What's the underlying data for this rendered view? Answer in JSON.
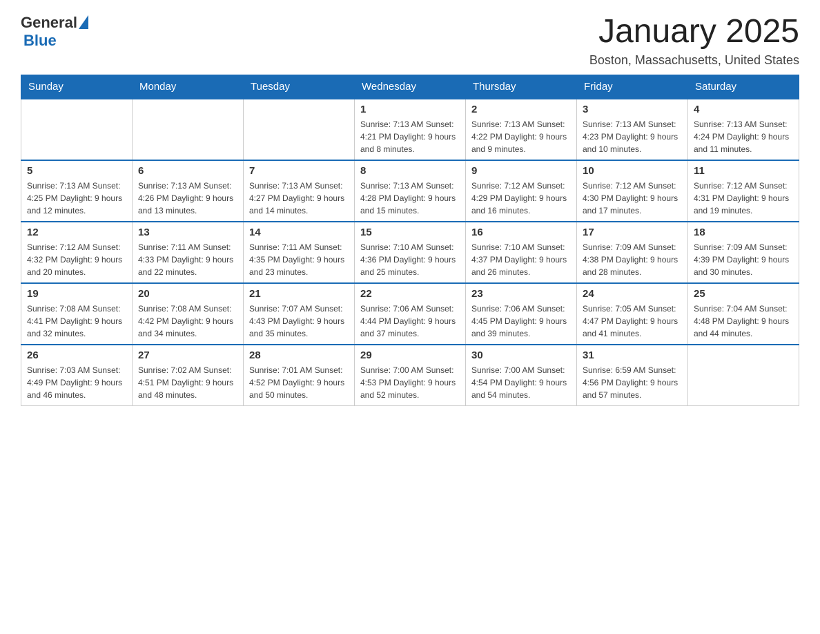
{
  "header": {
    "logo_general": "General",
    "logo_blue": "Blue",
    "month_title": "January 2025",
    "location": "Boston, Massachusetts, United States"
  },
  "weekdays": [
    "Sunday",
    "Monday",
    "Tuesday",
    "Wednesday",
    "Thursday",
    "Friday",
    "Saturday"
  ],
  "weeks": [
    [
      {
        "day": "",
        "info": ""
      },
      {
        "day": "",
        "info": ""
      },
      {
        "day": "",
        "info": ""
      },
      {
        "day": "1",
        "info": "Sunrise: 7:13 AM\nSunset: 4:21 PM\nDaylight: 9 hours\nand 8 minutes."
      },
      {
        "day": "2",
        "info": "Sunrise: 7:13 AM\nSunset: 4:22 PM\nDaylight: 9 hours\nand 9 minutes."
      },
      {
        "day": "3",
        "info": "Sunrise: 7:13 AM\nSunset: 4:23 PM\nDaylight: 9 hours\nand 10 minutes."
      },
      {
        "day": "4",
        "info": "Sunrise: 7:13 AM\nSunset: 4:24 PM\nDaylight: 9 hours\nand 11 minutes."
      }
    ],
    [
      {
        "day": "5",
        "info": "Sunrise: 7:13 AM\nSunset: 4:25 PM\nDaylight: 9 hours\nand 12 minutes."
      },
      {
        "day": "6",
        "info": "Sunrise: 7:13 AM\nSunset: 4:26 PM\nDaylight: 9 hours\nand 13 minutes."
      },
      {
        "day": "7",
        "info": "Sunrise: 7:13 AM\nSunset: 4:27 PM\nDaylight: 9 hours\nand 14 minutes."
      },
      {
        "day": "8",
        "info": "Sunrise: 7:13 AM\nSunset: 4:28 PM\nDaylight: 9 hours\nand 15 minutes."
      },
      {
        "day": "9",
        "info": "Sunrise: 7:12 AM\nSunset: 4:29 PM\nDaylight: 9 hours\nand 16 minutes."
      },
      {
        "day": "10",
        "info": "Sunrise: 7:12 AM\nSunset: 4:30 PM\nDaylight: 9 hours\nand 17 minutes."
      },
      {
        "day": "11",
        "info": "Sunrise: 7:12 AM\nSunset: 4:31 PM\nDaylight: 9 hours\nand 19 minutes."
      }
    ],
    [
      {
        "day": "12",
        "info": "Sunrise: 7:12 AM\nSunset: 4:32 PM\nDaylight: 9 hours\nand 20 minutes."
      },
      {
        "day": "13",
        "info": "Sunrise: 7:11 AM\nSunset: 4:33 PM\nDaylight: 9 hours\nand 22 minutes."
      },
      {
        "day": "14",
        "info": "Sunrise: 7:11 AM\nSunset: 4:35 PM\nDaylight: 9 hours\nand 23 minutes."
      },
      {
        "day": "15",
        "info": "Sunrise: 7:10 AM\nSunset: 4:36 PM\nDaylight: 9 hours\nand 25 minutes."
      },
      {
        "day": "16",
        "info": "Sunrise: 7:10 AM\nSunset: 4:37 PM\nDaylight: 9 hours\nand 26 minutes."
      },
      {
        "day": "17",
        "info": "Sunrise: 7:09 AM\nSunset: 4:38 PM\nDaylight: 9 hours\nand 28 minutes."
      },
      {
        "day": "18",
        "info": "Sunrise: 7:09 AM\nSunset: 4:39 PM\nDaylight: 9 hours\nand 30 minutes."
      }
    ],
    [
      {
        "day": "19",
        "info": "Sunrise: 7:08 AM\nSunset: 4:41 PM\nDaylight: 9 hours\nand 32 minutes."
      },
      {
        "day": "20",
        "info": "Sunrise: 7:08 AM\nSunset: 4:42 PM\nDaylight: 9 hours\nand 34 minutes."
      },
      {
        "day": "21",
        "info": "Sunrise: 7:07 AM\nSunset: 4:43 PM\nDaylight: 9 hours\nand 35 minutes."
      },
      {
        "day": "22",
        "info": "Sunrise: 7:06 AM\nSunset: 4:44 PM\nDaylight: 9 hours\nand 37 minutes."
      },
      {
        "day": "23",
        "info": "Sunrise: 7:06 AM\nSunset: 4:45 PM\nDaylight: 9 hours\nand 39 minutes."
      },
      {
        "day": "24",
        "info": "Sunrise: 7:05 AM\nSunset: 4:47 PM\nDaylight: 9 hours\nand 41 minutes."
      },
      {
        "day": "25",
        "info": "Sunrise: 7:04 AM\nSunset: 4:48 PM\nDaylight: 9 hours\nand 44 minutes."
      }
    ],
    [
      {
        "day": "26",
        "info": "Sunrise: 7:03 AM\nSunset: 4:49 PM\nDaylight: 9 hours\nand 46 minutes."
      },
      {
        "day": "27",
        "info": "Sunrise: 7:02 AM\nSunset: 4:51 PM\nDaylight: 9 hours\nand 48 minutes."
      },
      {
        "day": "28",
        "info": "Sunrise: 7:01 AM\nSunset: 4:52 PM\nDaylight: 9 hours\nand 50 minutes."
      },
      {
        "day": "29",
        "info": "Sunrise: 7:00 AM\nSunset: 4:53 PM\nDaylight: 9 hours\nand 52 minutes."
      },
      {
        "day": "30",
        "info": "Sunrise: 7:00 AM\nSunset: 4:54 PM\nDaylight: 9 hours\nand 54 minutes."
      },
      {
        "day": "31",
        "info": "Sunrise: 6:59 AM\nSunset: 4:56 PM\nDaylight: 9 hours\nand 57 minutes."
      },
      {
        "day": "",
        "info": ""
      }
    ]
  ]
}
